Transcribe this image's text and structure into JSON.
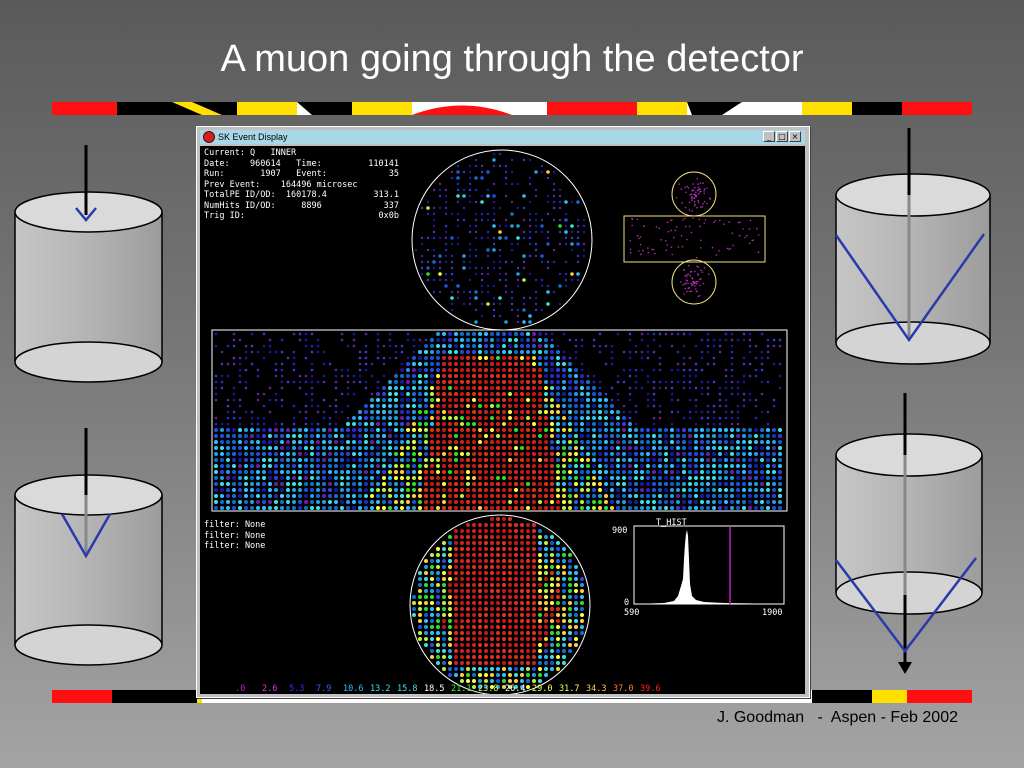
{
  "slide": {
    "title": "A muon going through the detector",
    "footer": "J. Goodman   -  Aspen - Feb 2002"
  },
  "window": {
    "title": "SK Event Display",
    "controls": [
      "_",
      "□",
      "×"
    ]
  },
  "event_info": [
    {
      "left": "Current: Q   INNER",
      "right": ""
    },
    {
      "left": "Date:    960614   Time:",
      "right": "110141"
    },
    {
      "left": "Run:       1907   Event:",
      "right": "35"
    },
    {
      "left": "Prev Event:    164496 microsec",
      "right": ""
    },
    {
      "left": "TotalPE ID/OD:  160178.4",
      "right": "313.1"
    },
    {
      "left": "NumHits ID/OD:     8896",
      "right": "337"
    },
    {
      "left": "Trig ID:",
      "right": "0x0b"
    }
  ],
  "filters": [
    "filter: None",
    "filter: None",
    "filter: None"
  ],
  "histogram": {
    "title": "T_HIST",
    "y_max": "900",
    "y_min": "0",
    "x_min": "590",
    "x_max": "1900"
  },
  "color_scale": [
    {
      "value": ".0",
      "color": "#c020c0"
    },
    {
      "value": "2.6",
      "color": "#d040d0"
    },
    {
      "value": "5.3",
      "color": "#3030ff"
    },
    {
      "value": "7.9",
      "color": "#3060ff"
    },
    {
      "value": "10.6",
      "color": "#30c0ff"
    },
    {
      "value": "13.2",
      "color": "#40e0e0"
    },
    {
      "value": "15.8",
      "color": "#40e0e0"
    },
    {
      "value": "18.5",
      "color": "#ffffff"
    },
    {
      "value": "21.1",
      "color": "#30ff30"
    },
    {
      "value": "23.8",
      "color": "#d0ff40"
    },
    {
      "value": "26.4",
      "color": "#ffffff"
    },
    {
      "value": "29.0",
      "color": "#ffff40"
    },
    {
      "value": "31.7",
      "color": "#ffff40"
    },
    {
      "value": "34.3",
      "color": "#ffd040"
    },
    {
      "value": "37.0",
      "color": "#ff8030"
    },
    {
      "value": "39.6",
      "color": "#ff2020"
    }
  ]
}
